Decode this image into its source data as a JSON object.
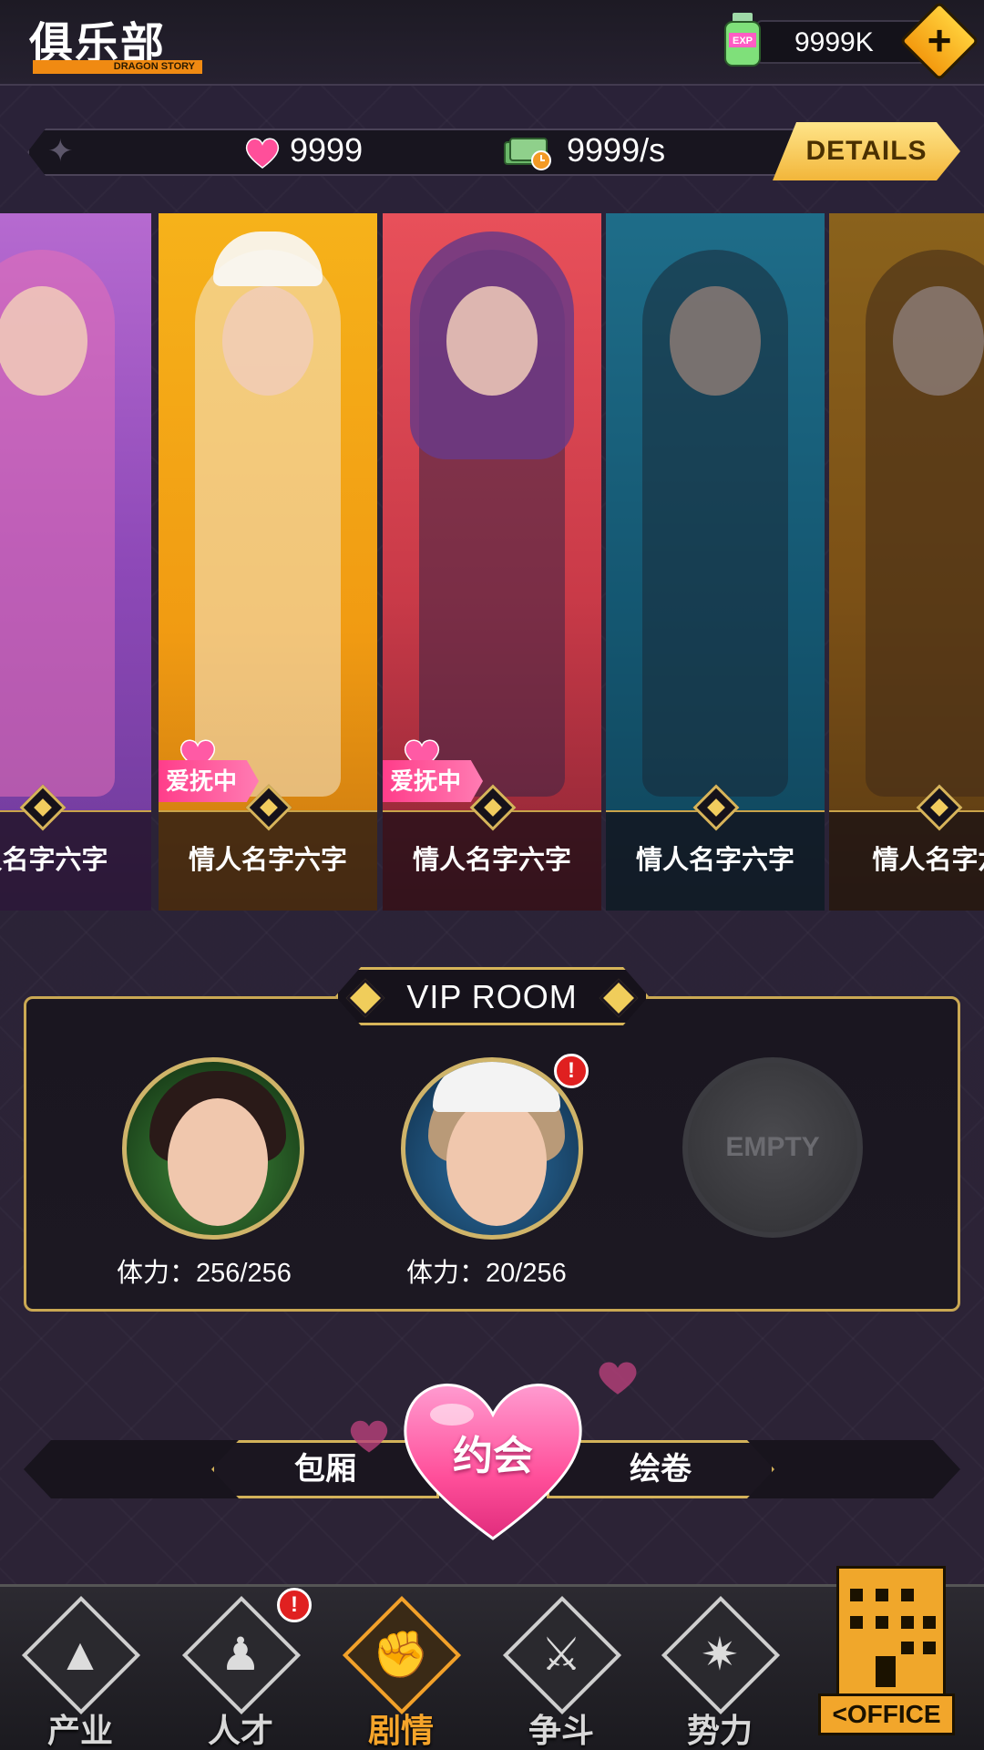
{
  "header": {
    "title": "俱乐部",
    "subtitle": "DRAGON STORY",
    "exp_value": "9999K",
    "exp_icon": "exp-bottle-icon",
    "plus_label": "+"
  },
  "resources": {
    "hearts": "9999",
    "cash_rate": "9999/s",
    "details_label": "DETAILS"
  },
  "cards": [
    {
      "name": "人名字六字",
      "status": "",
      "palette": "pink"
    },
    {
      "name": "情人名字六字",
      "status": "爱抚中",
      "palette": "gold"
    },
    {
      "name": "情人名字六字",
      "status": "爱抚中",
      "palette": "red"
    },
    {
      "name": "情人名字六字",
      "status": "",
      "palette": "blue-locked"
    },
    {
      "name": "情人名字六",
      "status": "",
      "palette": "orange-locked"
    }
  ],
  "vip_room": {
    "title": "VIP ROOM",
    "slots": [
      {
        "stamina": "体力：256/256",
        "alert": false
      },
      {
        "stamina": "体力：20/256",
        "alert": true
      },
      {
        "empty_label": "EMPTY"
      }
    ]
  },
  "actions": {
    "left_label": "包厢",
    "center_label": "约会",
    "right_label": "绘卷"
  },
  "nav": {
    "items": [
      {
        "label": "产业",
        "icon": "industry-icon",
        "active": false,
        "alert": false
      },
      {
        "label": "人才",
        "icon": "talent-icon",
        "active": false,
        "alert": true
      },
      {
        "label": "剧情",
        "icon": "story-fist-icon",
        "active": true,
        "alert": false
      },
      {
        "label": "争斗",
        "icon": "fight-swords-icon",
        "active": false,
        "alert": false
      },
      {
        "label": "势力",
        "icon": "power-knuckles-icon",
        "active": false,
        "alert": false
      }
    ],
    "office_label": "<OFFICE",
    "alert_mark": "!"
  },
  "colors": {
    "accent_gold": "#d3b25a",
    "heart_pink": "#ff4f9a",
    "office_orange": "#f2a62b",
    "active_orange": "#f5a42a"
  }
}
